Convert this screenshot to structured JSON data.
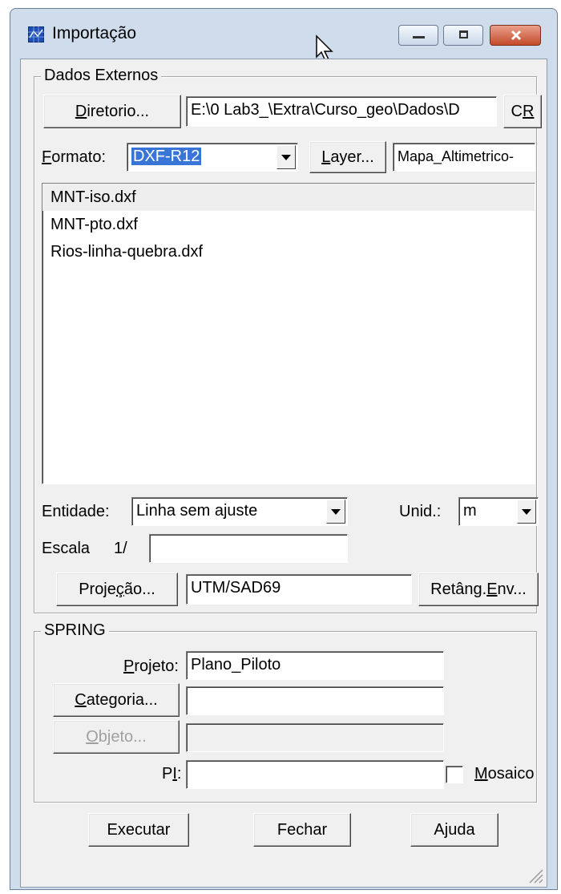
{
  "window": {
    "title": "Importação",
    "buttons": [
      "minimize",
      "maximize",
      "close"
    ],
    "icon": "map-grid-icon"
  },
  "dados_externos": {
    "group_label": "Dados Externos",
    "diretorio_button": {
      "underline": "D",
      "rest": "iretorio..."
    },
    "path_value": "E:\\0 Lab3_\\Extra\\Curso_geo\\Dados\\D",
    "cr_button": {
      "pre": "C",
      "underline": "R"
    },
    "formato_label": {
      "underline": "F",
      "rest": "ormato:"
    },
    "formato_value": "DXF-R12",
    "layer_button": {
      "underline": "L",
      "rest": "ayer..."
    },
    "layer_value": "Mapa_Altimetrico-",
    "files": [
      "MNT-iso.dxf",
      "MNT-pto.dxf",
      "Rios-linha-quebra.dxf"
    ],
    "entidade_label": "Entidade:",
    "entidade_value": "Linha sem ajuste",
    "unid_label": "Unid.:",
    "unid_value": "m",
    "escala_label": "Escala",
    "escala_prefix": "1/",
    "escala_value": "",
    "projecao_button": {
      "pre": "Proje",
      "underline": "ç",
      "rest": "ão..."
    },
    "projecao_value": "UTM/SAD69",
    "retang_button": {
      "pre": "Retâng. ",
      "underline": "E",
      "rest": "nv..."
    }
  },
  "spring": {
    "group_label": "SPRING",
    "projeto_label": {
      "underline": "P",
      "rest": "rojeto:"
    },
    "projeto_value": "Plano_Piloto",
    "categoria_button": {
      "underline": "C",
      "rest": "ategoria..."
    },
    "categoria_value": "",
    "objeto_button": {
      "underline": "O",
      "rest": "bjeto..."
    },
    "objeto_value": "",
    "pi_label": {
      "pre": "P",
      "underline": "I",
      "rest": ":"
    },
    "pi_value": "",
    "mosaico_label": {
      "underline": "M",
      "rest": "osaico"
    },
    "mosaico_checked": false
  },
  "footer": {
    "executar": "Executar",
    "fechar": "Fechar",
    "ajuda": "Ajuda"
  }
}
